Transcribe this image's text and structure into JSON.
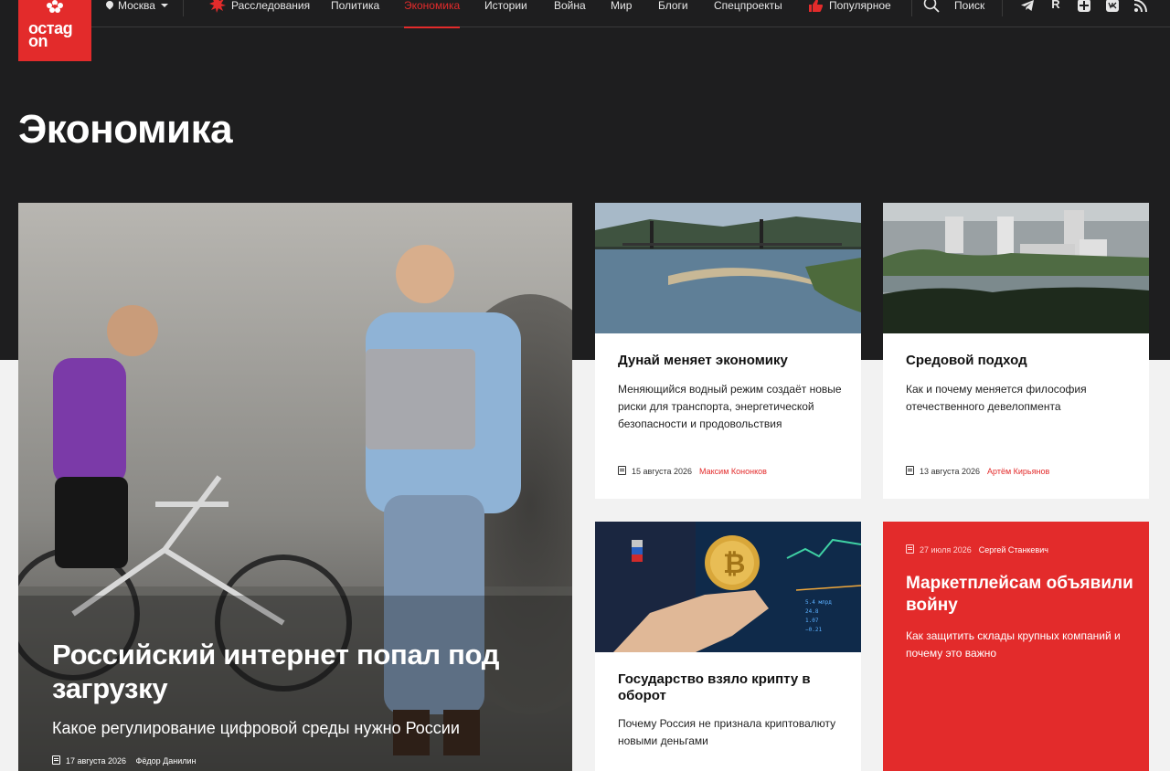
{
  "header": {
    "logo_text_line1": "остаg",
    "logo_text_line2": "on",
    "city": "Москва",
    "nav": [
      "Расследования",
      "Политика",
      "Экономика",
      "Истории",
      "Война",
      "Мир",
      "Блоги",
      "Спецпроекты",
      "Популярное"
    ],
    "active_nav": "Экономика",
    "search_label": "Поиск",
    "social_icons": [
      "telegram-icon",
      "rutube-icon",
      "dzen-icon",
      "vk-icon",
      "rss-icon"
    ],
    "accent_color": "#e32b2b"
  },
  "page_title": "Экономика",
  "hero": {
    "title": "Российский интернет попал под загрузку",
    "subtitle": "Какое регулирование цифровой среды нужно России",
    "date": "17 августа 2026",
    "author": "Фёдор Данилин"
  },
  "cards": [
    {
      "title": "Дунай меняет экономику",
      "desc": "Меняющийся водный режим создаёт новые риски для транспорта, энергетической безопасности и продовольствия",
      "date": "15 августа 2026",
      "author": "Максим Кононков"
    },
    {
      "title": "Средовой подход",
      "desc": "Как и почему меняется философия отечественного девелопмента",
      "date": "13 августа 2026",
      "author": "Артём Кирьянов"
    },
    {
      "title": "Государство взяло крипту в оборот",
      "desc": "Почему Россия не признала криптовалюту новыми деньгами",
      "date": "",
      "author": ""
    }
  ],
  "red_card": {
    "title": "Маркетплейсам объявили войну",
    "desc": "Как защитить склады крупных компаний и почему это важно",
    "date": "27 июля 2026",
    "author": "Сергей Станкевич"
  }
}
